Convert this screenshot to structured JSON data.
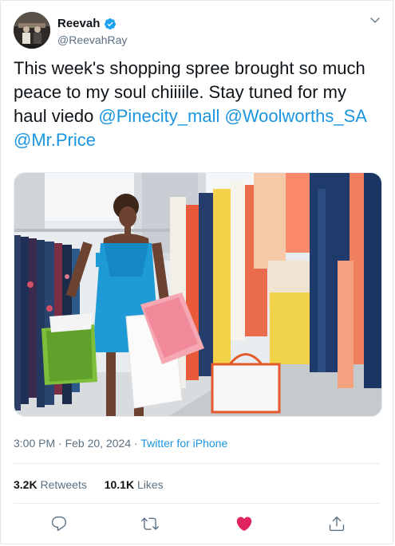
{
  "user": {
    "display_name": "Reevah",
    "handle": "ReevahRay",
    "verified": true
  },
  "tweet": {
    "text_parts": [
      {
        "text": "This week's shopping spree brought so much peace to my soul chiiiile. Stay tuned for my haul viedo ",
        "type": "text"
      },
      {
        "text": "@Pinecity_mall",
        "type": "mention"
      },
      {
        "text": " ",
        "type": "text"
      },
      {
        "text": "@Woolworths_SA",
        "type": "mention"
      },
      {
        "text": " ",
        "type": "text"
      },
      {
        "text": "@Mr.Price",
        "type": "mention"
      }
    ]
  },
  "meta": {
    "time": "3:00 PM",
    "separator1": " · ",
    "date": "Feb 20, 2024",
    "separator2": " · ",
    "source": "Twitter for iPhone"
  },
  "stats": {
    "retweets_count": "3.2K",
    "retweets_label": "Retweets",
    "likes_count": "10.1K",
    "likes_label": "Likes"
  },
  "colors": {
    "link": "#1b95e0",
    "secondary_text": "#5b7083",
    "like_active": "#e0245e"
  },
  "icons": {
    "reply": "reply-icon",
    "retweet": "retweet-icon",
    "like": "heart-icon",
    "share": "share-icon"
  }
}
